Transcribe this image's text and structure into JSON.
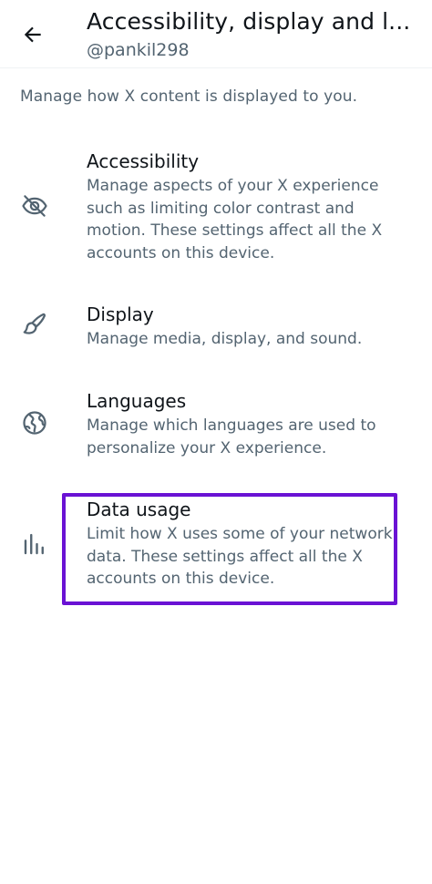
{
  "header": {
    "title": "Accessibility, display and l...",
    "username": "@pankil298"
  },
  "intro": "Manage how X content is displayed to you.",
  "items": [
    {
      "label": "Accessibility",
      "description": "Manage aspects of your X experience such as limiting color contrast and motion. These settings affect all the X accounts on this device.",
      "icon": "eye-slash-icon"
    },
    {
      "label": "Display",
      "description": "Manage media, display, and sound.",
      "icon": "brush-icon"
    },
    {
      "label": "Languages",
      "description": "Manage which languages are used to personalize your X experience.",
      "icon": "globe-icon"
    },
    {
      "label": "Data usage",
      "description": "Limit how X uses some of your network data. These settings affect all the X accounts on this device.",
      "icon": "bar-chart-icon"
    }
  ],
  "colors": {
    "text_primary": "#0f1419",
    "text_secondary": "#536471",
    "highlight": "#6a12d4"
  }
}
